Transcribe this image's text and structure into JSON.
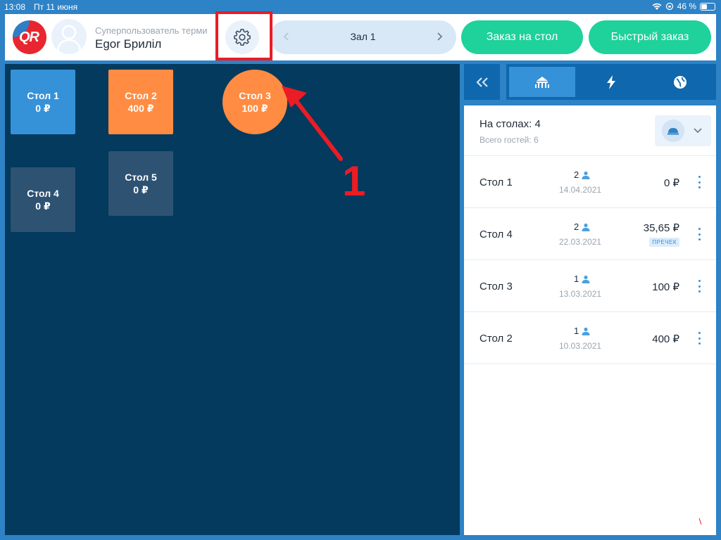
{
  "status": {
    "time": "13:08",
    "date": "Пт 11 июня",
    "battery": "46 %"
  },
  "header": {
    "logo_text": "QR",
    "user_role": "Суперпользователь терми",
    "user_name": "Egor Брилiл",
    "hall_name": "Зал 1",
    "order_button": "Заказ на стол",
    "quick_button": "Быстрый заказ"
  },
  "floor": {
    "tables": [
      {
        "name": "Стол 1",
        "amount": "0 ₽",
        "state": "active",
        "color": "#3592d8"
      },
      {
        "name": "Стол 2",
        "amount": "400 ₽",
        "state": "busy",
        "color": "#ff8c42"
      },
      {
        "name": "Стол 3",
        "amount": "100 ₽",
        "state": "busy",
        "color": "#ff8c42"
      },
      {
        "name": "Стол 4",
        "amount": "0 ₽",
        "state": "free",
        "color": "#2e5272"
      },
      {
        "name": "Стол 5",
        "amount": "0 ₽",
        "state": "free",
        "color": "#2e5272"
      }
    ],
    "annotation_number": "1"
  },
  "summary": {
    "title": "На столах: 4",
    "subtitle": "Всего гостей: 6"
  },
  "orders": [
    {
      "table": "Стол 1",
      "guests": "2",
      "date": "14.04.2021",
      "amount": "0 ₽",
      "badge": ""
    },
    {
      "table": "Стол 4",
      "guests": "2",
      "date": "22.03.2021",
      "amount": "35,65 ₽",
      "badge": "ПРЕЧЕК"
    },
    {
      "table": "Стол 3",
      "guests": "1",
      "date": "13.03.2021",
      "amount": "100 ₽",
      "badge": ""
    },
    {
      "table": "Стол 2",
      "guests": "1",
      "date": "10.03.2021",
      "amount": "400 ₽",
      "badge": ""
    }
  ],
  "colors": {
    "accent": "#1fd19b",
    "highlight": "#ea1c24",
    "floor_bg": "#033a5e",
    "primary": "#2e82c6"
  },
  "icons": [
    "wifi-icon",
    "battery-icon",
    "gear-icon",
    "chevron-left-icon",
    "chevron-right-icon",
    "double-chevron-left-icon",
    "tables-icon",
    "lightning-icon",
    "globe-icon",
    "cloche-icon",
    "chevron-down-icon",
    "person-icon",
    "more-vertical-icon"
  ]
}
